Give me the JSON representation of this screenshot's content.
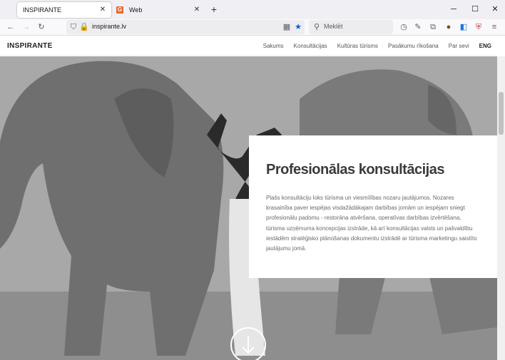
{
  "browser": {
    "tabs": [
      {
        "title": "INSPIRANTE",
        "active": true
      },
      {
        "title": "Web",
        "favicon": "G",
        "active": false
      }
    ],
    "url": "inspirante.lv",
    "search_placeholder": "Meklēt"
  },
  "site": {
    "logo": "INSPIRANTE",
    "nav": [
      "Sakums",
      "Konsultācijas",
      "Kultūras tūrisms",
      "Pasākumu rīkošana",
      "Par sevi",
      "ENG"
    ],
    "hero_title": "Profesionālas konsultācijas",
    "hero_text": "Plašs konsultāciju loks tūrisma un viesmīlības nozaru jautājumos. Nozares krasainība paver iespējas visdažādākajam darbības jomām un iespējam sniegt profesionālu padomu - restorāna atvēršana, operatīvas darbības izvērtēšana, tūrisma uzņēmuma koncepcijas izstrāde, kā arī konsultācijas valsts un pašvaldību iestādēm stratēģisko plānošanas dokumentu izstrādē ar tūrisma marketingu saistīto jautājumu jomā."
  }
}
